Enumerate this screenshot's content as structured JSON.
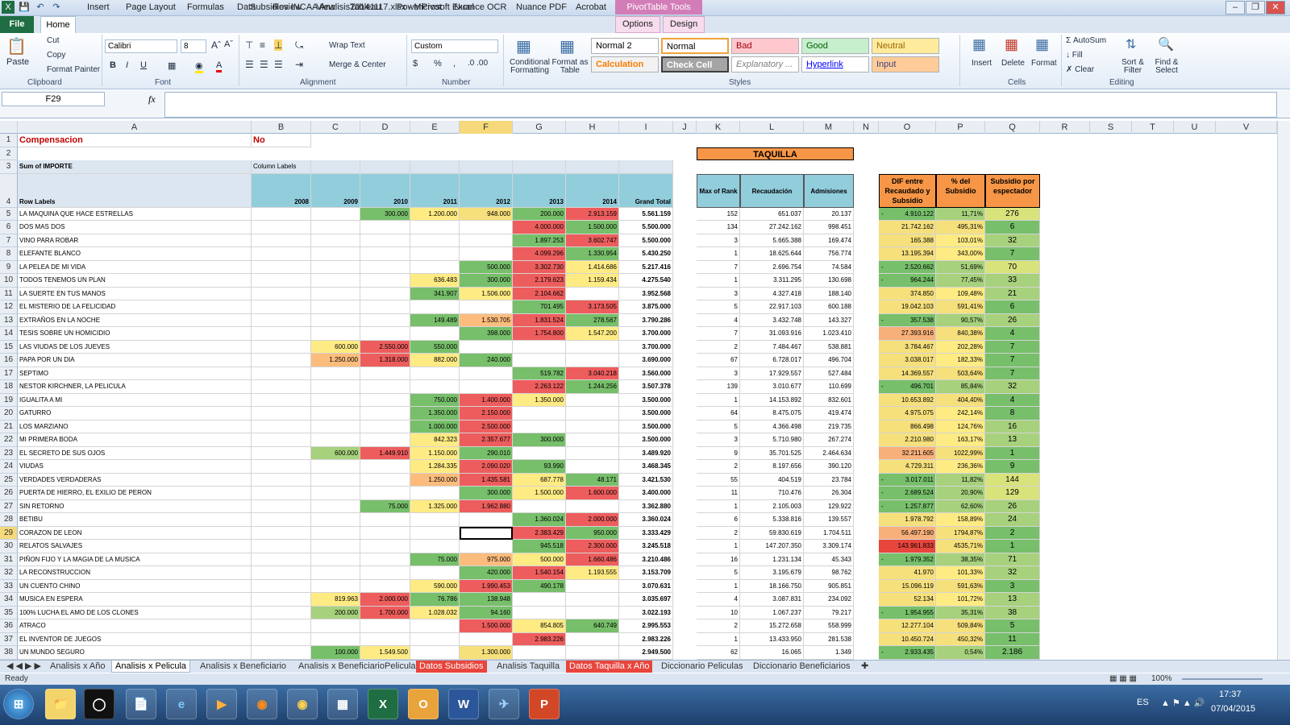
{
  "window": {
    "title": "Subsidios INCAA Analisis20141117.xlsx - Microsoft Excel",
    "context_tab": "PivotTable Tools"
  },
  "ribbon": {
    "tabs": [
      "File",
      "Home",
      "Insert",
      "Page Layout",
      "Formulas",
      "Data",
      "Review",
      "View",
      "Tableau",
      "PowerPivot",
      "Nuance OCR",
      "Nuance PDF",
      "Acrobat",
      "Options",
      "Design"
    ],
    "clipboard": {
      "paste": "Paste",
      "cut": "Cut",
      "copy": "Copy",
      "format_painter": "Format Painter",
      "label": "Clipboard"
    },
    "font": {
      "name": "Calibri",
      "size": "8",
      "label": "Font"
    },
    "alignment": {
      "wrap": "Wrap Text",
      "merge": "Merge & Center",
      "label": "Alignment"
    },
    "number": {
      "format": "Custom",
      "label": "Number"
    },
    "styles": {
      "conditional": "Conditional Formatting",
      "format_table": "Format as Table",
      "boxes": [
        "Normal 2",
        "Normal",
        "Bad",
        "Good",
        "Neutral",
        "Calculation",
        "Check Cell",
        "Explanatory ...",
        "Hyperlink",
        "Input"
      ],
      "label": "Styles"
    },
    "cells": {
      "insert": "Insert",
      "delete": "Delete",
      "format": "Format",
      "label": "Cells"
    },
    "editing": {
      "autosum": "AutoSum",
      "fill": "Fill",
      "clear": "Clear",
      "sort": "Sort & Filter",
      "find": "Find & Select",
      "label": "Editing"
    }
  },
  "formula_bar": {
    "name_box": "F29",
    "fx": "fx",
    "value": ""
  },
  "columns": [
    "A",
    "B",
    "C",
    "D",
    "E",
    "F",
    "G",
    "H",
    "I",
    "J",
    "K",
    "L",
    "M",
    "N",
    "O",
    "P",
    "Q",
    "R",
    "S",
    "T",
    "U",
    "V"
  ],
  "pivot": {
    "filter_label": "Compensacion",
    "filter_value": "No",
    "sum_label": "Sum of IMPORTE",
    "col_labels": "Column Labels",
    "row_labels": "Row Labels",
    "years": [
      "2008",
      "2009",
      "2010",
      "2011",
      "2012",
      "2013",
      "2014"
    ],
    "grand_total": "Grand Total"
  },
  "taquilla": {
    "title": "TAQUILLA",
    "headers": [
      "Max of Rank",
      "Recaudación",
      "Admisiones"
    ]
  },
  "extra_headers": [
    "DIF entre Recaudado y Subsidio",
    "% del Subsidio",
    "Subsidio por espectador"
  ],
  "rows": [
    [
      "LA MAQUINA QUE HACE ESTRELLAS",
      "",
      "",
      "300.000",
      "1.200.000",
      "948.000",
      "200.000",
      "2.913.159",
      "5.561.159",
      "152",
      "651.037",
      "20.137",
      "-",
      "4.910.122",
      "11,71%",
      "276"
    ],
    [
      "DOS MAS DOS",
      "",
      "",
      "",
      "",
      "",
      "4.000.000",
      "1.500.000",
      "5.500.000",
      "134",
      "27.242.162",
      "998.451",
      "",
      "21.742.162",
      "495,31%",
      "6"
    ],
    [
      "VINO PARA ROBAR",
      "",
      "",
      "",
      "",
      "",
      "1.897.253",
      "3.602.747",
      "5.500.000",
      "3",
      "5.665.388",
      "169.474",
      "",
      "165.388",
      "103,01%",
      "32"
    ],
    [
      "ELEFANTE BLANCO",
      "",
      "",
      "",
      "",
      "",
      "4.099.296",
      "1.330.954",
      "5.430.250",
      "1",
      "18.625.644",
      "756.774",
      "",
      "13.195.394",
      "343,00%",
      "7"
    ],
    [
      "LA PELEA DE MI VIDA",
      "",
      "",
      "",
      "",
      "500.000",
      "3.302.730",
      "1.414.686",
      "5.217.416",
      "7",
      "2.696.754",
      "74.584",
      "-",
      "2.520.662",
      "51,69%",
      "70"
    ],
    [
      "TODOS TENEMOS UN PLAN",
      "",
      "",
      "",
      "636.483",
      "300.000",
      "2.179.623",
      "1.159.434",
      "4.275.540",
      "1",
      "3.311.295",
      "130.698",
      "-",
      "964.244",
      "77,45%",
      "33"
    ],
    [
      "LA SUERTE EN TUS MANOS",
      "",
      "",
      "",
      "341.907",
      "1.506.000",
      "2.104.662",
      "",
      "3.952.568",
      "3",
      "4.327.418",
      "188.140",
      "",
      "374.850",
      "109,48%",
      "21"
    ],
    [
      "EL MISTERIO DE LA FELICIDAD",
      "",
      "",
      "",
      "",
      "",
      "701.495",
      "3.173.505",
      "3.875.000",
      "5",
      "22.917.103",
      "600.188",
      "",
      "19.042.103",
      "591,41%",
      "6"
    ],
    [
      "EXTRAÑOS EN LA NOCHE",
      "",
      "",
      "",
      "149.489",
      "1.530.705",
      "1.831.524",
      "278.567",
      "3.790.286",
      "4",
      "3.432.748",
      "143.327",
      "-",
      "357.538",
      "90,57%",
      "26"
    ],
    [
      "TESIS SOBRE UN HOMICIDIO",
      "",
      "",
      "",
      "",
      "398.000",
      "1.754.800",
      "1.547.200",
      "3.700.000",
      "7",
      "31.093.916",
      "1.023.410",
      "",
      "27.393.916",
      "840,38%",
      "4"
    ],
    [
      "LAS VIUDAS DE LOS JUEVES",
      "",
      "600.000",
      "2.550.000",
      "550.000",
      "",
      "",
      "",
      "3.700.000",
      "2",
      "7.484.467",
      "538.881",
      "",
      "3.784.467",
      "202,28%",
      "7"
    ],
    [
      "PAPA POR UN DIA",
      "",
      "1.250.000",
      "1.318.000",
      "882.000",
      "240.000",
      "",
      "",
      "3.690.000",
      "67",
      "6.728.017",
      "496.704",
      "",
      "3.038.017",
      "182,33%",
      "7"
    ],
    [
      "SEPTIMO",
      "",
      "",
      "",
      "",
      "",
      "519.782",
      "3.040.218",
      "3.560.000",
      "3",
      "17.929.557",
      "527.484",
      "",
      "14.369.557",
      "503,64%",
      "7"
    ],
    [
      "NESTOR KIRCHNER, LA PELICULA",
      "",
      "",
      "",
      "",
      "",
      "2.263.122",
      "1.244.256",
      "3.507.378",
      "139",
      "3.010.677",
      "110.699",
      "-",
      "496.701",
      "85,84%",
      "32"
    ],
    [
      "IGUALITA A MI",
      "",
      "",
      "",
      "750.000",
      "1.400.000",
      "1.350.000",
      "",
      "3.500.000",
      "1",
      "14.153.892",
      "832.601",
      "",
      "10.653.892",
      "404,40%",
      "4"
    ],
    [
      "GATURRO",
      "",
      "",
      "",
      "1.350.000",
      "2.150.000",
      "",
      "",
      "3.500.000",
      "64",
      "8.475.075",
      "419.474",
      "",
      "4.975.075",
      "242,14%",
      "8"
    ],
    [
      "LOS MARZIANO",
      "",
      "",
      "",
      "1.000.000",
      "2.500.000",
      "",
      "",
      "3.500.000",
      "5",
      "4.366.498",
      "219.735",
      "",
      "866.498",
      "124,76%",
      "16"
    ],
    [
      "MI PRIMERA BODA",
      "",
      "",
      "",
      "842.323",
      "2.357.677",
      "300.000",
      "",
      "3.500.000",
      "3",
      "5.710.980",
      "267.274",
      "",
      "2.210.980",
      "163,17%",
      "13"
    ],
    [
      "EL SECRETO DE SUS OJOS",
      "",
      "600.000",
      "1.449.910",
      "1.150.000",
      "290.010",
      "",
      "",
      "3.489.920",
      "9",
      "35.701.525",
      "2.464.634",
      "",
      "32.211.605",
      "1022,99%",
      "1"
    ],
    [
      "VIUDAS",
      "",
      "",
      "",
      "1.284.335",
      "2.090.020",
      "93.990",
      "",
      "3.468.345",
      "2",
      "8.197.656",
      "390.120",
      "",
      "4.729.311",
      "236,36%",
      "9"
    ],
    [
      "VERDADES VERDADERAS",
      "",
      "",
      "",
      "1.250.000",
      "1.435.581",
      "687.778",
      "48.171",
      "3.421.530",
      "55",
      "404.519",
      "23.784",
      "-",
      "3.017.011",
      "11,82%",
      "144"
    ],
    [
      "PUERTA DE HIERRO, EL EXILIO DE PERON",
      "",
      "",
      "",
      "",
      "300.000",
      "1.500.000",
      "1.600.000",
      "3.400.000",
      "11",
      "710.476",
      "26.304",
      "-",
      "2.689.524",
      "20,90%",
      "129"
    ],
    [
      "SIN RETORNO",
      "",
      "",
      "75.000",
      "1.325.000",
      "1.962.880",
      "",
      "",
      "3.362.880",
      "1",
      "2.105.003",
      "129.922",
      "-",
      "1.257.877",
      "62,60%",
      "26"
    ],
    [
      "BETIBU",
      "",
      "",
      "",
      "",
      "",
      "1.360.024",
      "2.000.000",
      "3.360.024",
      "6",
      "5.338.816",
      "139.557",
      "",
      "1.978.792",
      "158,89%",
      "24"
    ],
    [
      "CORAZON DE LEON",
      "",
      "",
      "",
      "",
      "",
      "2.383.429",
      "950.000",
      "3.333.429",
      "2",
      "59.830.619",
      "1.704.511",
      "",
      "56.497.190",
      "1794,87%",
      "2"
    ],
    [
      "RELATOS SALVAJES",
      "",
      "",
      "",
      "",
      "",
      "945.518",
      "2.300.000",
      "3.245.518",
      "1",
      "147.207.350",
      "3.309.174",
      "",
      "143.961.833",
      "4535,71%",
      "1"
    ],
    [
      "PIÑON FIJO Y LA MAGIA DE LA MUSICA",
      "",
      "",
      "",
      "75.000",
      "975.000",
      "500.000",
      "1.660.486",
      "3.210.486",
      "16",
      "1.231.134",
      "45.343",
      "-",
      "1.979.352",
      "38,35%",
      "71"
    ],
    [
      "LA RECONSTRUCCION",
      "",
      "",
      "",
      "",
      "420.000",
      "1.540.154",
      "1.193.555",
      "3.153.709",
      "5",
      "3.195.679",
      "98.762",
      "",
      "41.970",
      "101,33%",
      "32"
    ],
    [
      "UN CUENTO CHINO",
      "",
      "",
      "",
      "590.000",
      "1.990.453",
      "490.178",
      "",
      "3.070.631",
      "1",
      "18.166.750",
      "905.851",
      "",
      "15.096.119",
      "591,63%",
      "3"
    ],
    [
      "MUSICA EN ESPERA",
      "",
      "819.963",
      "2.000.000",
      "76.786",
      "138.948",
      "",
      "",
      "3.035.697",
      "4",
      "3.087.831",
      "234.092",
      "",
      "52.134",
      "101,72%",
      "13"
    ],
    [
      "100% LUCHA EL AMO DE LOS CLONES",
      "",
      "200.000",
      "1.700.000",
      "1.028.032",
      "94.160",
      "",
      "",
      "3.022.193",
      "10",
      "1.067.237",
      "79.217",
      "-",
      "1.954.955",
      "35,31%",
      "38"
    ],
    [
      "ATRACO",
      "",
      "",
      "",
      "",
      "1.500.000",
      "854.805",
      "640.749",
      "2.995.553",
      "2",
      "15.272.658",
      "558.999",
      "",
      "12.277.104",
      "509,84%",
      "5"
    ],
    [
      "EL INVENTOR DE JUEGOS",
      "",
      "",
      "",
      "",
      "",
      "2.983.226",
      "",
      "2.983.226",
      "1",
      "13.433.950",
      "281.538",
      "",
      "10.450.724",
      "450,32%",
      "11"
    ],
    [
      "UN MUNDO SEGURO",
      "",
      "100.000",
      "1.549.500",
      "",
      "1.300.000",
      "",
      "",
      "2.949.500",
      "62",
      "16.065",
      "1.349",
      "-",
      "2.933.435",
      "0,54%",
      "2.186"
    ]
  ],
  "row_numbers": [
    "5",
    "6",
    "7",
    "8",
    "9",
    "10",
    "11",
    "12",
    "13",
    "14",
    "15",
    "16",
    "17",
    "18",
    "19",
    "20",
    "21",
    "22",
    "23",
    "24",
    "25",
    "26",
    "27",
    "28",
    "29",
    "30",
    "31",
    "32",
    "33",
    "34",
    "35",
    "36",
    "37",
    "38"
  ],
  "sheet_tabs": [
    "Analisis x Año",
    "Analisis x Pelicula",
    "Analisis x Beneficiario",
    "Analisis x BeneficiarioPelicula",
    "Datos Subsidios",
    "Analisis Taquilla",
    "Datos Taquilla x Año",
    "Diccionario Peliculas",
    "Diccionario Beneficiarios"
  ],
  "status": {
    "ready": "Ready",
    "zoom": "100%"
  },
  "taskbar": {
    "lang": "ES",
    "time": "17:37",
    "date": "07/04/2015"
  }
}
